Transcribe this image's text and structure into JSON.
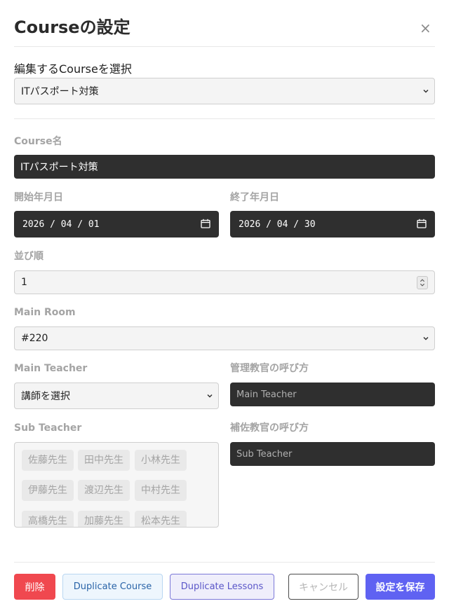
{
  "modal": {
    "title": "Courseの設定",
    "close_glyph": "×"
  },
  "course_selector": {
    "label": "編集するCourseを選択",
    "selected": "ITパスポート対策"
  },
  "form": {
    "course_name": {
      "label": "Course名",
      "value": "ITパスポート対策"
    },
    "start_date": {
      "label": "開始年月日",
      "value": "2026 / 04 / 01"
    },
    "end_date": {
      "label": "終了年月日",
      "value": "2026 / 04 / 30"
    },
    "sort_order": {
      "label": "並び順",
      "value": "1"
    },
    "main_room": {
      "label": "Main Room",
      "selected": "#220"
    },
    "main_teacher": {
      "label": "Main Teacher",
      "selected": "講師を選択"
    },
    "main_teacher_title": {
      "label": "管理教官の呼び方",
      "placeholder": "Main Teacher"
    },
    "sub_teacher": {
      "label": "Sub Teacher",
      "options": [
        "佐藤先生",
        "田中先生",
        "小林先生",
        "伊藤先生",
        "渡辺先生",
        "中村先生",
        "高橋先生",
        "加藤先生",
        "松本先生"
      ]
    },
    "sub_teacher_title": {
      "label": "補佐教官の呼び方",
      "placeholder": "Sub Teacher"
    }
  },
  "footer": {
    "delete_label": "削除",
    "duplicate_course_label": "Duplicate Course",
    "duplicate_lessons_label": "Duplicate Lessons",
    "cancel_label": "キャンセル",
    "save_label": "設定を保存"
  },
  "icons": {
    "close": "close-icon",
    "chevron": "chevron-down-icon",
    "calendar": "calendar-icon",
    "spinner": "number-spinner-icon"
  },
  "colors": {
    "delete": "#f0484f",
    "save": "#5f62f2",
    "dark_field": "#2f2f2f"
  }
}
